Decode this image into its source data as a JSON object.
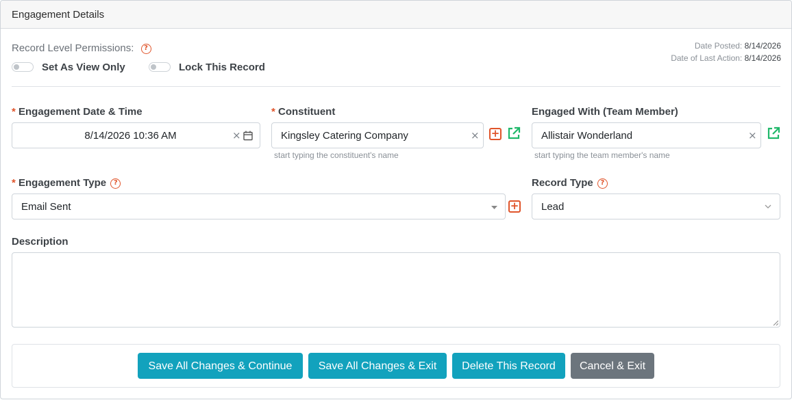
{
  "panel": {
    "title": "Engagement Details"
  },
  "permissions": {
    "label": "Record Level Permissions:",
    "toggles": [
      {
        "label": "Set As View Only",
        "on": false
      },
      {
        "label": "Lock This Record",
        "on": false
      }
    ]
  },
  "meta": {
    "date_posted_label": "Date Posted:",
    "date_posted": "8/14/2026",
    "last_action_label": "Date of Last Action:",
    "last_action": "8/14/2026"
  },
  "fields": {
    "engagement_date": {
      "label": "Engagement Date & Time",
      "value": "8/14/2026 10:36 AM",
      "required": true
    },
    "constituent": {
      "label": "Constituent",
      "value": "Kingsley Catering Company",
      "hint": "start typing the constituent's name",
      "required": true
    },
    "engaged_with": {
      "label": "Engaged With (Team Member)",
      "value": "Allistair Wonderland",
      "hint": "start typing the team member's name"
    },
    "engagement_type": {
      "label": "Engagement Type",
      "value": "Email Sent",
      "required": true
    },
    "record_type": {
      "label": "Record Type",
      "value": "Lead"
    },
    "description": {
      "label": "Description",
      "value": ""
    }
  },
  "buttons": {
    "save_continue": "Save All Changes & Continue",
    "save_exit": "Save All Changes & Exit",
    "delete": "Delete This Record",
    "cancel": "Cancel & Exit"
  },
  "colors": {
    "required": "#e0542a",
    "link_icon": "#1fb86a",
    "primary_button": "#12a2bd",
    "secondary_button": "#6c757d"
  }
}
